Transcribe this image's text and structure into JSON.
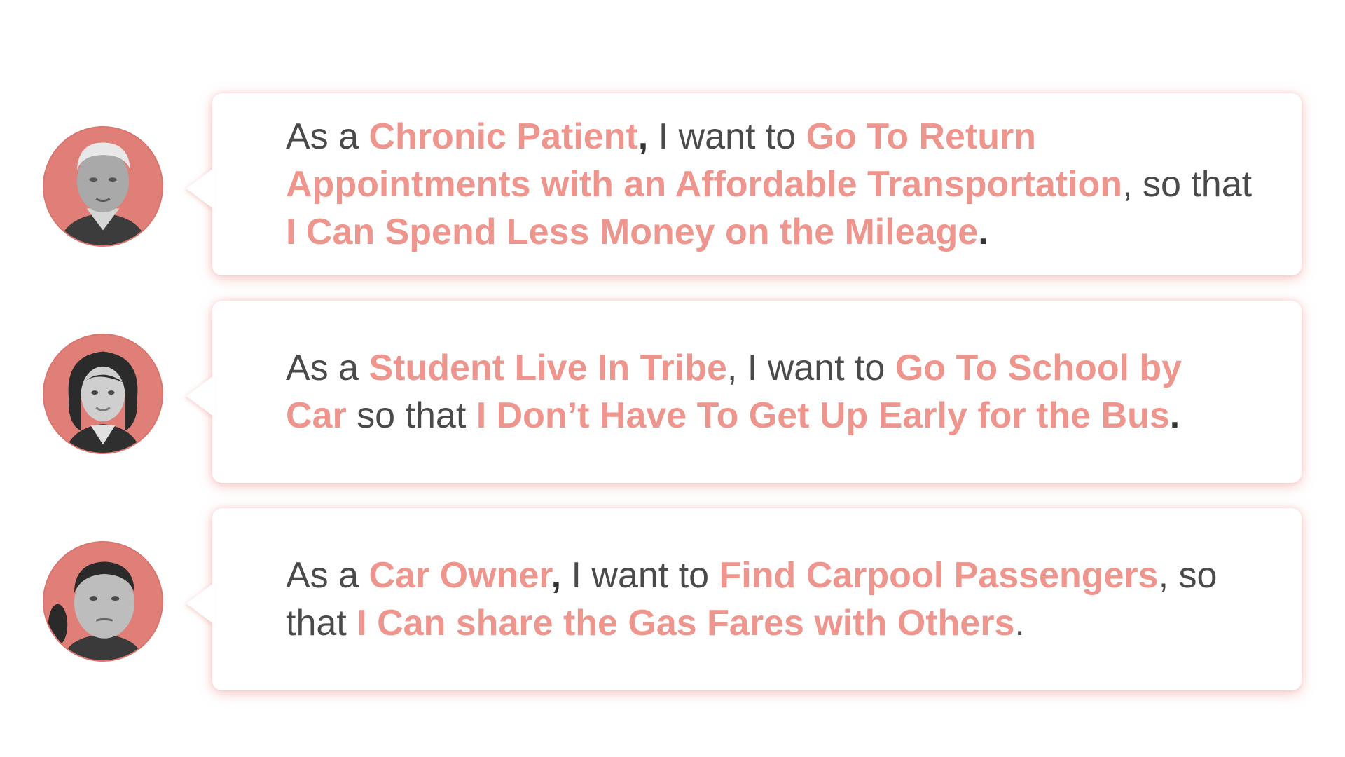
{
  "stories": [
    {
      "avatar_icon": "elderly-man-avatar-icon",
      "prefix": "As a ",
      "role": "Chronic Patient",
      "after_role": ",",
      "middle": " I want to ",
      "goal": "Go To Return Appointments with an Affordable Transportation",
      "after_goal": ", so that ",
      "benefit": "I Can Spend Less Money on the Mileage",
      "end": "."
    },
    {
      "avatar_icon": "young-woman-avatar-icon",
      "prefix": "As a ",
      "role": "Student Live In Tribe",
      "after_role": ",",
      "middle": " I want to ",
      "goal": "Go To School by Car",
      "after_goal": " so that ",
      "benefit": "I Don’t Have To Get Up Early for the Bus",
      "end": "."
    },
    {
      "avatar_icon": "man-avatar-icon",
      "prefix": "As a ",
      "role": "Car Owner",
      "after_role": ",",
      "middle": " I want to ",
      "goal": "Find Carpool Passengers",
      "after_goal": ", so that ",
      "benefit": "I Can share the Gas Fares with Others",
      "end": "."
    }
  ],
  "colors": {
    "highlight": "#ee958e",
    "text": "#4a4a4a",
    "avatar_bg": "#e07f78",
    "shadow": "#ee968e"
  }
}
